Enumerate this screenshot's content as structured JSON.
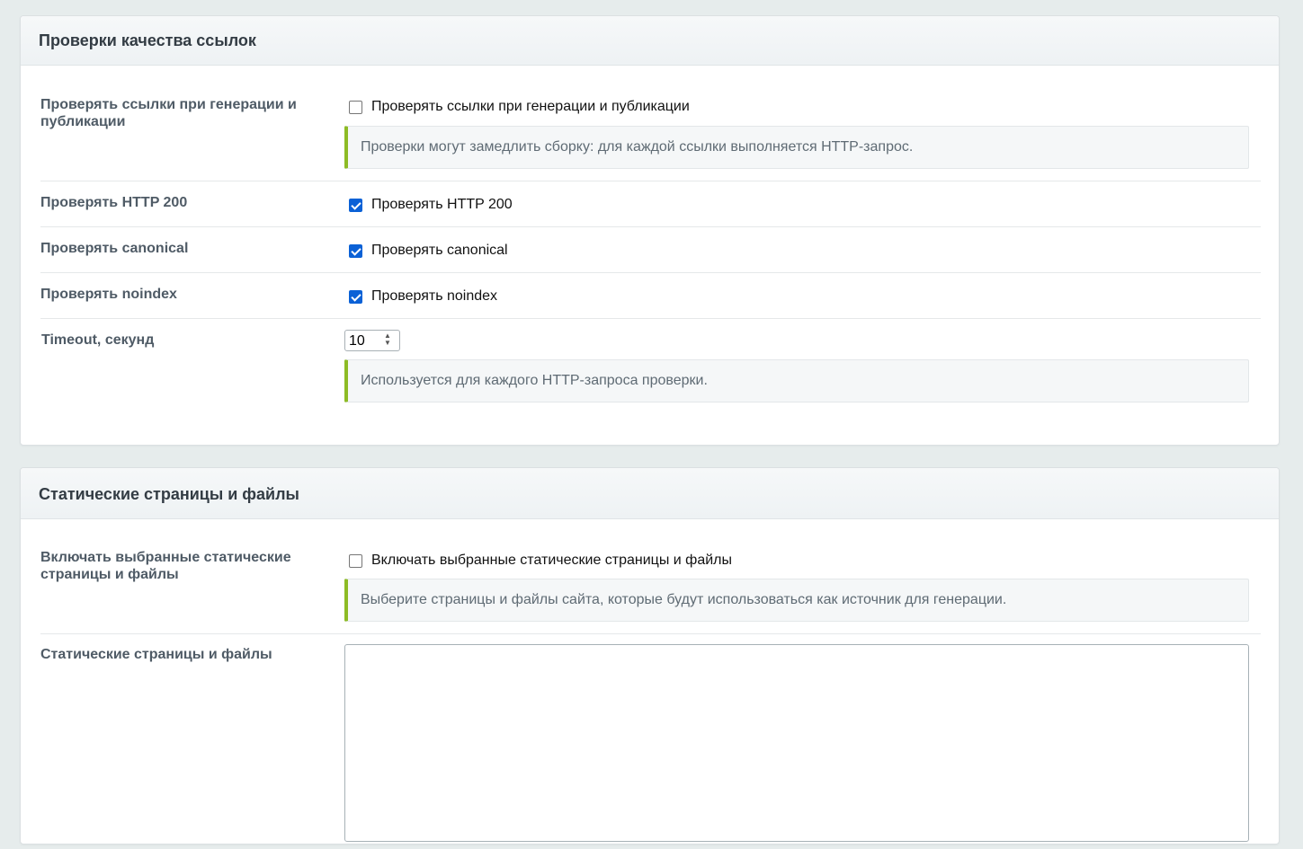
{
  "sections": [
    {
      "title": "Проверки качества ссылок",
      "rows": [
        {
          "label": "Проверять ссылки при генерации и публикации",
          "checkbox_label": "Проверять ссылки при генерации и публикации",
          "checked": false,
          "note": "Проверки могут замедлить сборку: для каждой ссылки выполняется HTTP-запрос."
        },
        {
          "label": "Проверять HTTP 200",
          "checkbox_label": "Проверять HTTP 200",
          "checked": true
        },
        {
          "label": "Проверять canonical",
          "checkbox_label": "Проверять canonical",
          "checked": true
        },
        {
          "label": "Проверять noindex",
          "checkbox_label": "Проверять noindex",
          "checked": true
        },
        {
          "label": "Timeout, секунд",
          "value": "10",
          "note": "Используется для каждого HTTP-запроса проверки."
        }
      ]
    },
    {
      "title": "Статические страницы и файлы",
      "rows": [
        {
          "label": "Включать выбранные статические страницы и файлы",
          "checkbox_label": "Включать выбранные статические страницы и файлы",
          "checked": false,
          "note": "Выберите страницы и файлы сайта, которые будут использоваться как источник для генерации."
        },
        {
          "label": "Статические страницы и файлы",
          "value": ""
        }
      ]
    }
  ],
  "colors": {
    "page_bg": "#e6ecec",
    "checkbox_accent": "#0b61d6",
    "note_accent": "#8dbb25"
  }
}
